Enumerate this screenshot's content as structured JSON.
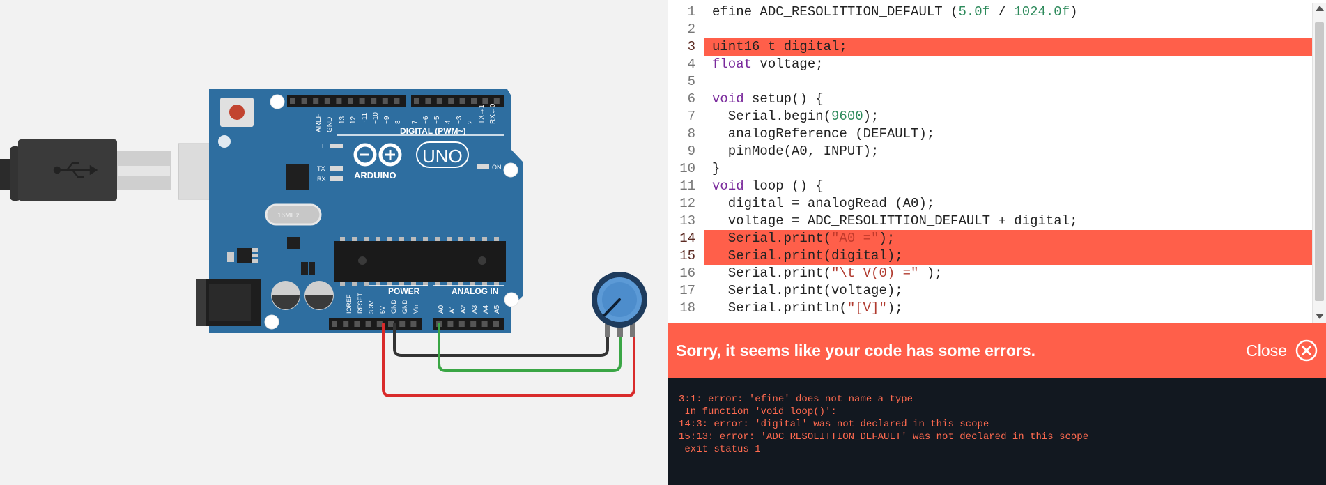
{
  "board": {
    "aref": "AREF",
    "gnd": "GND",
    "pins_top": [
      "13",
      "12",
      "~11",
      "~10",
      "~9",
      "8",
      "7",
      "~6",
      "~5",
      "4",
      "~3",
      "2",
      "TX→1",
      "RX←0"
    ],
    "digital_label": "DIGITAL (PWM~)",
    "led_l": "L",
    "led_tx": "TX",
    "led_rx": "RX",
    "led_on": "ON",
    "brand": "ARDUINO",
    "model": "UNO",
    "crystal": "16MHz",
    "power_label": "POWER",
    "analog_label": "ANALOG IN",
    "power_pins": [
      "IOREF",
      "RESET",
      "3.3V",
      "5V",
      "GND",
      "GND",
      "Vin"
    ],
    "analog_pins": [
      "A0",
      "A1",
      "A2",
      "A3",
      "A4",
      "A5"
    ]
  },
  "colors": {
    "board": "#2e6ea0",
    "wire_red": "#d92b2b",
    "wire_black": "#333333",
    "wire_green": "#3aa645",
    "error": "#ff5f4a",
    "console_bg": "#121820"
  },
  "code": {
    "lines": [
      {
        "n": "1",
        "err": false,
        "parts": [
          {
            "t": "efine ADC_RESOLITTION_DEFAULT ("
          },
          {
            "t": "5.0f",
            "c": "num"
          },
          {
            "t": " / "
          },
          {
            "t": "1024.0f",
            "c": "num"
          },
          {
            "t": ")"
          }
        ]
      },
      {
        "n": "2",
        "err": false,
        "parts": [
          {
            "t": ""
          }
        ]
      },
      {
        "n": "3",
        "err": true,
        "parts": [
          {
            "t": "uint16 t digital;"
          }
        ]
      },
      {
        "n": "4",
        "err": false,
        "parts": [
          {
            "t": "float",
            "c": "kw"
          },
          {
            "t": " voltage;"
          }
        ]
      },
      {
        "n": "5",
        "err": false,
        "parts": [
          {
            "t": ""
          }
        ]
      },
      {
        "n": "6",
        "err": false,
        "parts": [
          {
            "t": "void",
            "c": "kw"
          },
          {
            "t": " setup() {"
          }
        ]
      },
      {
        "n": "7",
        "err": false,
        "parts": [
          {
            "t": "  Serial.begin("
          },
          {
            "t": "9600",
            "c": "num"
          },
          {
            "t": ");"
          }
        ]
      },
      {
        "n": "8",
        "err": false,
        "parts": [
          {
            "t": "  analogReference (DEFAULT);"
          }
        ]
      },
      {
        "n": "9",
        "err": false,
        "parts": [
          {
            "t": "  pinMode(A0, INPUT);"
          }
        ]
      },
      {
        "n": "10",
        "err": false,
        "parts": [
          {
            "t": "}"
          }
        ]
      },
      {
        "n": "11",
        "err": false,
        "parts": [
          {
            "t": "void",
            "c": "kw"
          },
          {
            "t": " loop () {"
          }
        ]
      },
      {
        "n": "12",
        "err": false,
        "parts": [
          {
            "t": "  digital = analogRead (A0);"
          }
        ]
      },
      {
        "n": "13",
        "err": false,
        "parts": [
          {
            "t": "  voltage = ADC_RESOLITTION_DEFAULT + digital;"
          }
        ]
      },
      {
        "n": "14",
        "err": true,
        "parts": [
          {
            "t": "  Serial.print("
          },
          {
            "t": "\"A0 =\"",
            "c": "str"
          },
          {
            "t": ");"
          }
        ]
      },
      {
        "n": "15",
        "err": true,
        "parts": [
          {
            "t": "  Serial.print(digital);"
          }
        ]
      },
      {
        "n": "16",
        "err": false,
        "parts": [
          {
            "t": "  Serial.print("
          },
          {
            "t": "\"\\t V(0) =\"",
            "c": "str"
          },
          {
            "t": " );"
          }
        ]
      },
      {
        "n": "17",
        "err": false,
        "parts": [
          {
            "t": "  Serial.print(voltage);"
          }
        ]
      },
      {
        "n": "18",
        "err": false,
        "parts": [
          {
            "t": "  Serial.println("
          },
          {
            "t": "\"[V]\"",
            "c": "str"
          },
          {
            "t": ");"
          }
        ]
      }
    ]
  },
  "error_banner": {
    "title": "Sorry, it seems like your code has some errors.",
    "close_label": "Close"
  },
  "console": {
    "lines": [
      "3:1: error: 'efine' does not name a type",
      " In function 'void loop()':",
      "14:3: error: 'digital' was not declared in this scope",
      "15:13: error: 'ADC_RESOLITTION_DEFAULT' was not declared in this scope",
      " exit status 1"
    ]
  }
}
